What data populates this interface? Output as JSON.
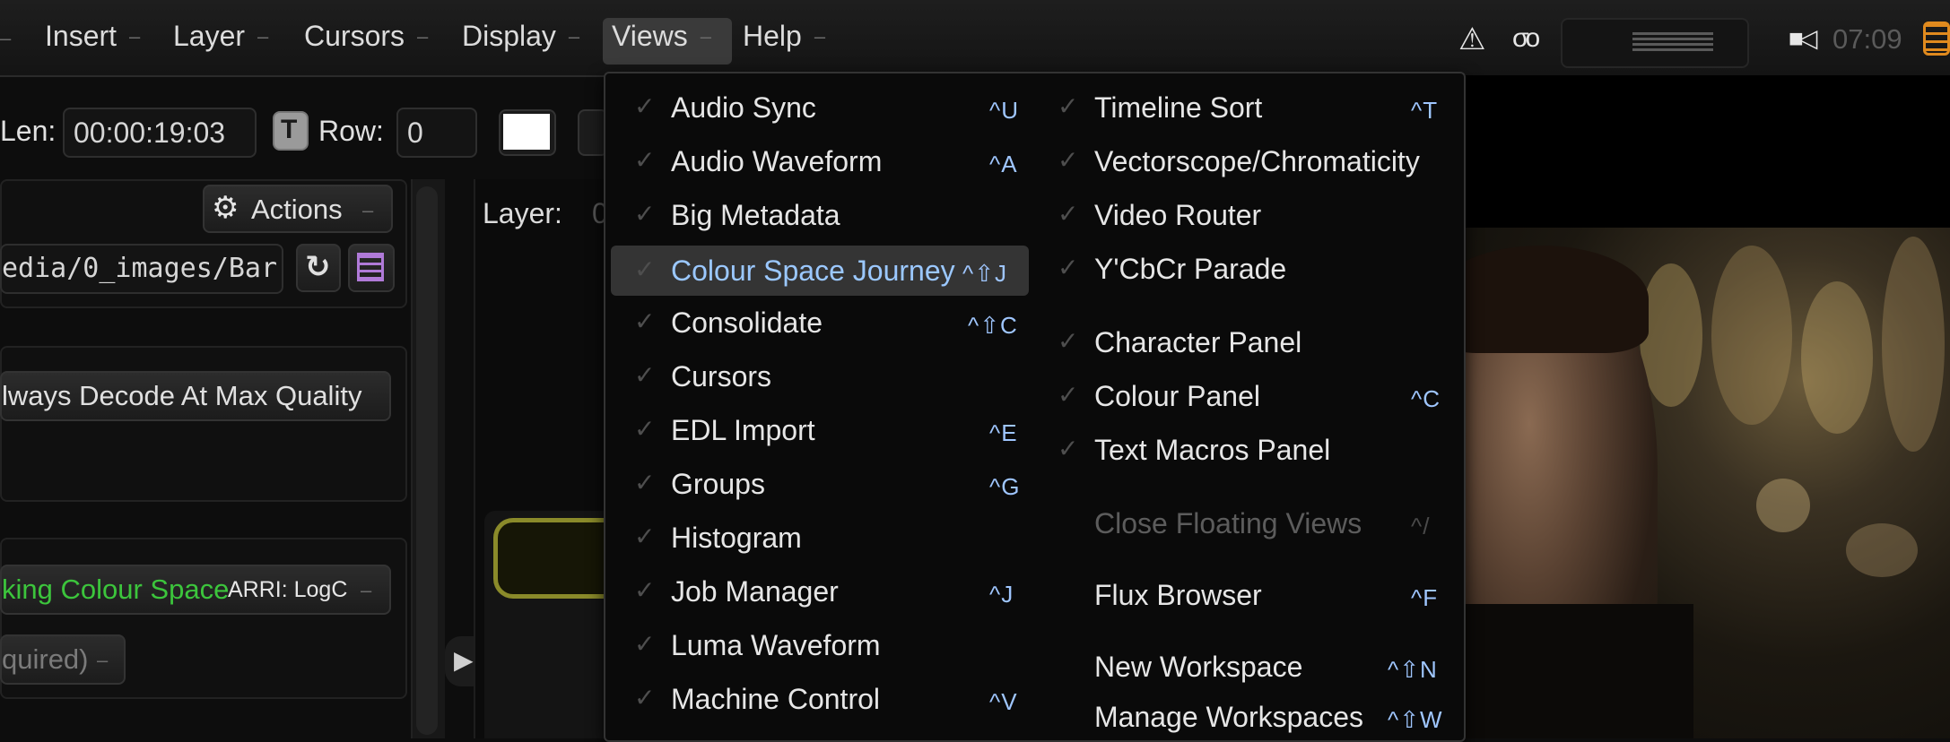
{
  "menubar": {
    "items": [
      {
        "label": "Insert"
      },
      {
        "label": "Layer"
      },
      {
        "label": "Cursors"
      },
      {
        "label": "Display"
      },
      {
        "label": "Views"
      },
      {
        "label": "Help"
      }
    ],
    "arrow": "–",
    "warning_glyph": "⚠",
    "glasses_glyph": "σο",
    "speaker_glyph": "■◁",
    "clock": "07:09"
  },
  "toolbar": {
    "len_label": "Len:",
    "len_value": "00:00:19:03",
    "t_button": "T",
    "row_label": "Row:",
    "row_value": "0"
  },
  "left_panel": {
    "actions_label": "Actions",
    "path_value": "edia/0_images/Bar",
    "decode_label": "lways Decode At Max Quality",
    "working_colour_label": "king Colour Space",
    "working_colour_value": "ARRI: LogC",
    "required_label": "quired)"
  },
  "center": {
    "layer_label": "Layer:",
    "layer_value": "0"
  },
  "views_menu": {
    "left_column": [
      {
        "label": "Audio Sync",
        "shortcut": "^U"
      },
      {
        "label": "Audio Waveform",
        "shortcut": "^A"
      },
      {
        "label": "Big Metadata",
        "shortcut": ""
      },
      {
        "label": "Colour Space Journey",
        "shortcut": "^⇧J"
      },
      {
        "label": "Consolidate",
        "shortcut": "^⇧C"
      },
      {
        "label": "Cursors",
        "shortcut": ""
      },
      {
        "label": "EDL Import",
        "shortcut": "^E"
      },
      {
        "label": "Groups",
        "shortcut": "^G"
      },
      {
        "label": "Histogram",
        "shortcut": ""
      },
      {
        "label": "Job Manager",
        "shortcut": "^J"
      },
      {
        "label": "Luma Waveform",
        "shortcut": ""
      },
      {
        "label": "Machine Control",
        "shortcut": "^V"
      }
    ],
    "right_column": [
      {
        "label": "Timeline Sort",
        "shortcut": "^T"
      },
      {
        "label": "Vectorscope/Chromaticity",
        "shortcut": ""
      },
      {
        "label": "Video Router",
        "shortcut": ""
      },
      {
        "label": "Y'CbCr Parade",
        "shortcut": ""
      },
      {
        "label": "Character Panel",
        "shortcut": ""
      },
      {
        "label": "Colour Panel",
        "shortcut": "^C"
      },
      {
        "label": "Text Macros Panel",
        "shortcut": ""
      },
      {
        "label": "Close Floating Views",
        "shortcut": "^/"
      },
      {
        "label": "Flux Browser",
        "shortcut": "^F"
      },
      {
        "label": "New Workspace",
        "shortcut": "^⇧N"
      },
      {
        "label": "Manage Workspaces",
        "shortcut": "^⇧W"
      }
    ],
    "checkmark": "✓",
    "selected_item": "Colour Space Journey",
    "disabled_item": "Close Floating Views"
  },
  "colors": {
    "accent_blue": "#9bc8ff",
    "working_colour_green": "#3cc53c",
    "clock_orange": "#e08a1e"
  }
}
